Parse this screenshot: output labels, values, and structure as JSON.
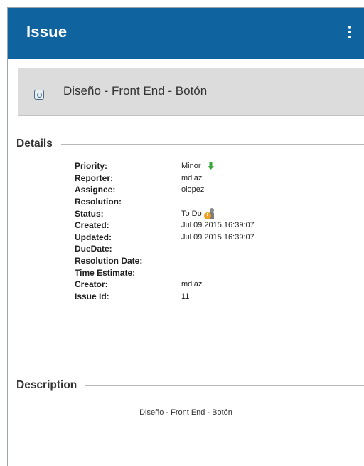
{
  "appbar": {
    "title": "Issue",
    "menu_icon": "more-vert-icon"
  },
  "summary": {
    "icon": "issue-type-icon",
    "text": "Diseño - Front End - Botón"
  },
  "details": {
    "heading": "Details",
    "rows": [
      {
        "label": "Priority:",
        "value": "Minor"
      },
      {
        "label": "Reporter:",
        "value": "mdiaz"
      },
      {
        "label": "Assignee:",
        "value": "olopez"
      },
      {
        "label": "Resolution:",
        "value": ""
      },
      {
        "label": "Status:",
        "value": "To Do"
      },
      {
        "label": "Created:",
        "value": "Jul 09 2015 16:39:07"
      },
      {
        "label": "Updated:",
        "value": "Jul 09 2015 16:39:07"
      },
      {
        "label": "DueDate:",
        "value": ""
      },
      {
        "label": "Resolution Date:",
        "value": ""
      },
      {
        "label": "Time Estimate:",
        "value": ""
      },
      {
        "label": "Creator:",
        "value": "mdiaz"
      },
      {
        "label": "Issue Id:",
        "value": "11"
      }
    ],
    "priority_icon": "arrow-down-icon",
    "priority_color": "#3aa53a",
    "status_icon": "person-status-icon",
    "status_badge_text": "!",
    "status_badge_color": "#f0a020"
  },
  "description": {
    "heading": "Description",
    "text": "Diseño - Front End - Botón"
  },
  "colors": {
    "appbar": "#0f64a0",
    "summary_bg": "#dcdcdc"
  }
}
